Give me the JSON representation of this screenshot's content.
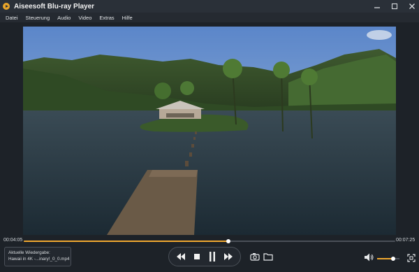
{
  "window": {
    "title": "Aiseesoft Blu-ray Player",
    "controls": [
      "minimize",
      "restore",
      "close"
    ]
  },
  "menu": [
    "Datei",
    "Steuerung",
    "Audio",
    "Video",
    "Extras",
    "Hilfe"
  ],
  "playback": {
    "elapsed": "00:04:05",
    "duration": "00:07:25",
    "progress": 0.55
  },
  "now_playing": {
    "label": "Aktuelle Wiedergabe:",
    "file": "Hawaii in 4K -...inary!_0_0.mp4"
  },
  "controls": {
    "buttons": [
      "rewind",
      "stop",
      "pause",
      "fast-forward"
    ]
  },
  "tools": [
    "snapshot",
    "open-folder"
  ],
  "volume": {
    "level": 0.72
  },
  "colors": {
    "accent": "#f0a830",
    "background": "#1d2228"
  }
}
